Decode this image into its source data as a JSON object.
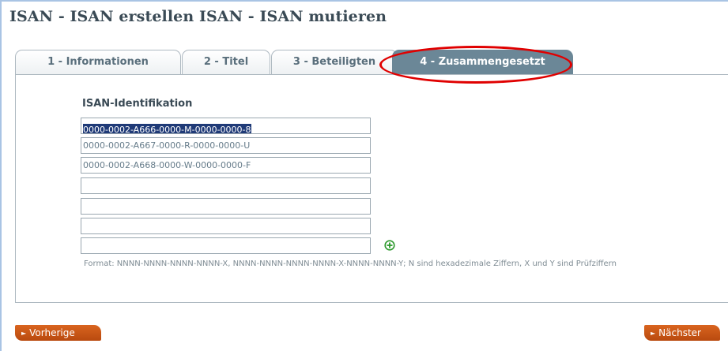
{
  "page": {
    "title": "ISAN - ISAN erstellen ISAN - ISAN mutieren"
  },
  "tabs": [
    {
      "label": "1 - Informationen"
    },
    {
      "label": "2 - Titel"
    },
    {
      "label": "3 - Beteiligten"
    },
    {
      "label": "4 - Zusammengesetzt",
      "active": true
    }
  ],
  "form": {
    "label": "ISAN-Identifikation",
    "inputs": [
      {
        "value": "0000-0002-A666-0000-M-0000-0000-8",
        "selected": true
      },
      {
        "value": "0000-0002-A667-0000-R-0000-0000-U"
      },
      {
        "value": "0000-0002-A668-0000-W-0000-0000-F"
      },
      {
        "value": ""
      },
      {
        "value": ""
      },
      {
        "value": ""
      },
      {
        "value": ""
      }
    ],
    "add_icon": "plus-circle-icon",
    "format_hint": "Format: NNNN-NNNN-NNNN-NNNN-X, NNNN-NNNN-NNNN-NNNN-X-NNNN-NNNN-Y; N sind hexadezimale Ziffern, X und Y sind Prüfziffern"
  },
  "navigation": {
    "prev_label": "Vorherige",
    "next_label": "Nächster"
  },
  "colors": {
    "active_tab": "#6b8797",
    "nav_button": "#c8551a",
    "highlight": "#e00000",
    "add_icon": "#2e9a2e"
  }
}
